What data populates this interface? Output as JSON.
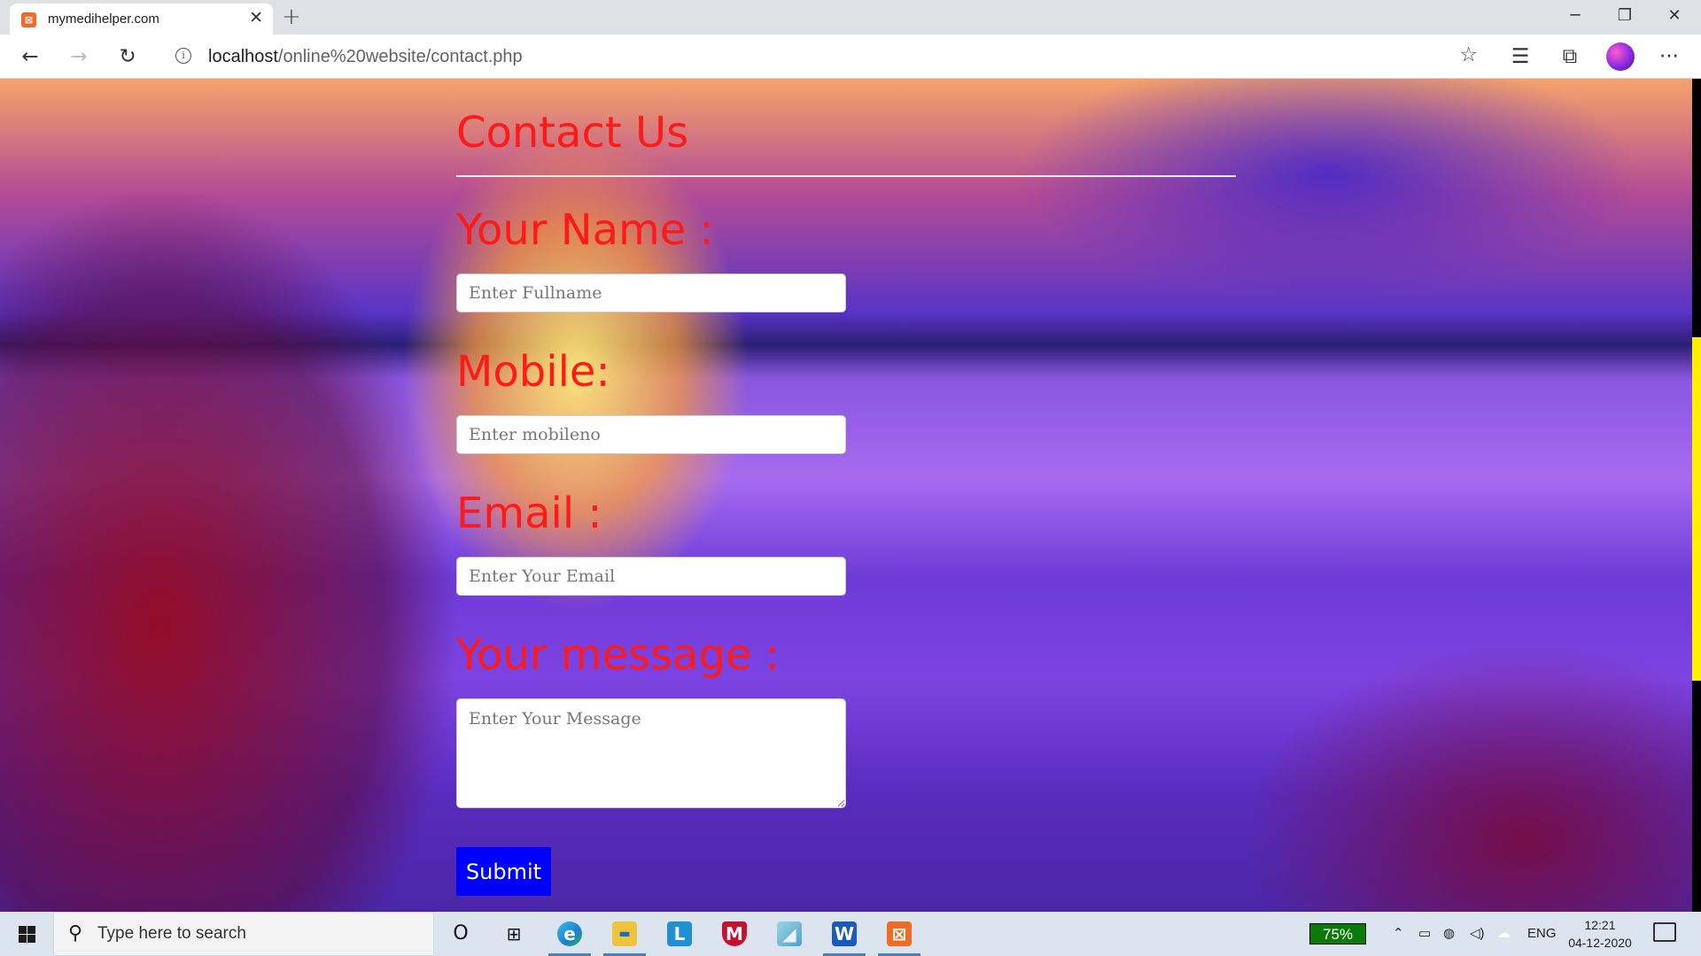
{
  "browser": {
    "tab_title": "mymedihelper.com",
    "tab_close": "✕",
    "new_tab": "+",
    "window_controls": {
      "minimize": "─",
      "restore": "❐",
      "close": "✕"
    },
    "url_host": "localhost",
    "url_path": "/online%20website/contact.php",
    "nav": {
      "back": "←",
      "forward": "→",
      "reload": "↻"
    },
    "toolbar_icons": {
      "favorite": "☆",
      "favorites_list": "☰",
      "collections": "⧉",
      "more": "···"
    }
  },
  "page": {
    "title": "Contact Us",
    "fields": [
      {
        "label": "Your Name :",
        "placeholder": "Enter Fullname"
      },
      {
        "label": "Mobile:",
        "placeholder": "Enter mobileno"
      },
      {
        "label": "Email :",
        "placeholder": "Enter Your Email"
      },
      {
        "label": "Your message :",
        "placeholder": "Enter Your Message"
      }
    ],
    "submit_label": "Submit",
    "colors": {
      "label": "#ff1a1a",
      "submit": "#0000ff",
      "scroll_thumb": "#ffee00"
    }
  },
  "taskbar": {
    "search_placeholder": "Type here to search",
    "apps": [
      {
        "name": "cortana-icon",
        "glyph": "O"
      },
      {
        "name": "task-view-icon",
        "glyph": "⊞"
      },
      {
        "name": "edge-icon",
        "glyph": "e"
      },
      {
        "name": "file-explorer-icon",
        "glyph": "▬"
      },
      {
        "name": "l-app-icon",
        "glyph": "L"
      },
      {
        "name": "mcafee-icon",
        "glyph": "M"
      },
      {
        "name": "notes-app-icon",
        "glyph": "◢"
      },
      {
        "name": "word-icon",
        "glyph": "W"
      },
      {
        "name": "xampp-icon",
        "glyph": "⊠"
      }
    ],
    "battery_percent": "75%",
    "language": "ENG",
    "time": "12:21",
    "date": "04-12-2020"
  }
}
